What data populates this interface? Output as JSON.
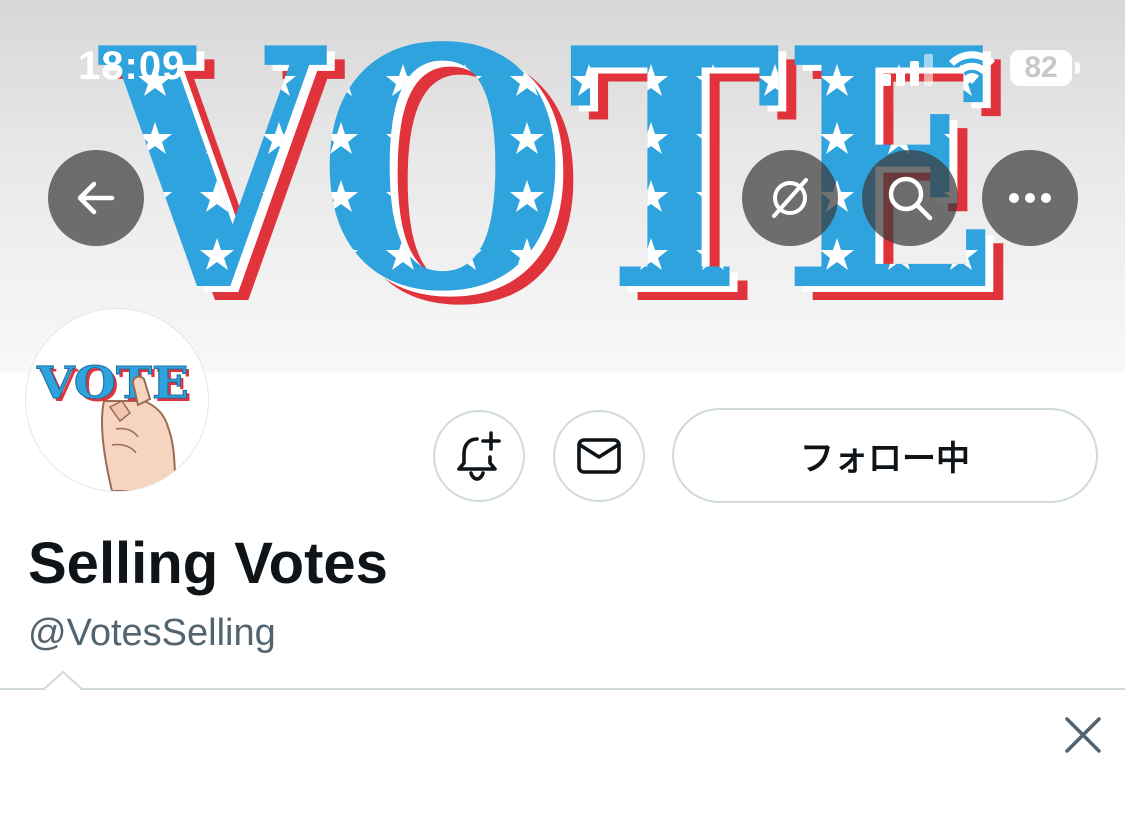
{
  "status_bar": {
    "time": "18:09",
    "battery": "82"
  },
  "banner": {
    "word": "VOTE",
    "colors": {
      "blue": "#2fa3dd",
      "red": "#e0333b",
      "star": "#ffffff"
    }
  },
  "nav_icons": [
    "back-arrow-icon",
    "grok-icon",
    "search-icon",
    "more-icon"
  ],
  "profile": {
    "avatar_text": "VOTE",
    "display_name": "Selling Votes",
    "handle": "@VotesSelling"
  },
  "actions": {
    "notifications_icon": "bell-plus-icon",
    "message_icon": "mail-icon",
    "follow_label": "フォロー中"
  },
  "popover": {
    "close_icon": "close-icon"
  },
  "theme": {
    "text_primary": "#0f1419",
    "text_secondary": "#536471",
    "border": "#cfd9de"
  }
}
